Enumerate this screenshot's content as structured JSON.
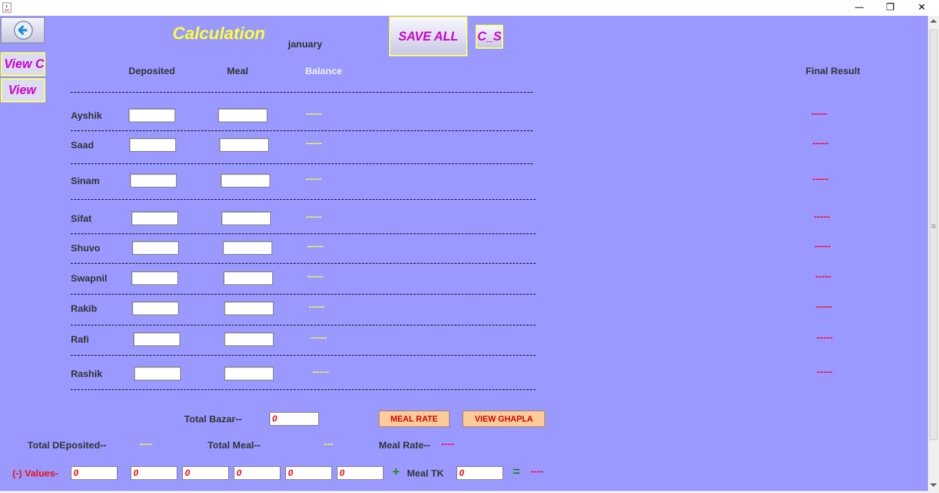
{
  "window": {
    "minimize": "—",
    "restore": "❐",
    "close": "✕"
  },
  "header": {
    "title": "Calculation",
    "month": "january",
    "save_all": "SAVE ALL",
    "cs": "C_S"
  },
  "sidebar": {
    "view_c": "View C",
    "view": "View"
  },
  "columns": {
    "deposited": "Deposited",
    "meal": "Meal",
    "balance": "Balance",
    "final_result": "Final Result"
  },
  "members": [
    {
      "name": "Ayshik",
      "balance": "-----",
      "final": "-----"
    },
    {
      "name": "Saad",
      "balance": "-----",
      "final": "-----"
    },
    {
      "name": "Sinam",
      "balance": "-----",
      "final": "-----"
    },
    {
      "name": "Sifat",
      "balance": "-----",
      "final": "-----"
    },
    {
      "name": "Shuvo",
      "balance": "-----",
      "final": "-----"
    },
    {
      "name": "Swapnil",
      "balance": "-----",
      "final": "-----"
    },
    {
      "name": "Rakib",
      "balance": "-----",
      "final": "-----"
    },
    {
      "name": "Rafi",
      "balance": "-----",
      "final": "-----"
    },
    {
      "name": "Rashik",
      "balance": "-----",
      "final": "-----"
    }
  ],
  "totals": {
    "total_bazar_label": "Total Bazar--",
    "total_bazar_value": "0",
    "meal_rate_button": "MEAL RATE",
    "view_ghapla_button": "VIEW GHAPLA",
    "total_deposited_label": "Total DEposited--",
    "total_deposited_value": "----",
    "total_meal_label": "Total Meal--",
    "total_meal_value": "---",
    "meal_rate_label": "Meal Rate--",
    "meal_rate_value": "----"
  },
  "bottom": {
    "values_label": "(-) Values-",
    "values": [
      "0",
      "0",
      "0",
      "0",
      "0",
      "0"
    ],
    "plus": "+",
    "meal_tk_label": "Meal TK",
    "meal_tk_value": "0",
    "equals": "=",
    "result": "----"
  }
}
